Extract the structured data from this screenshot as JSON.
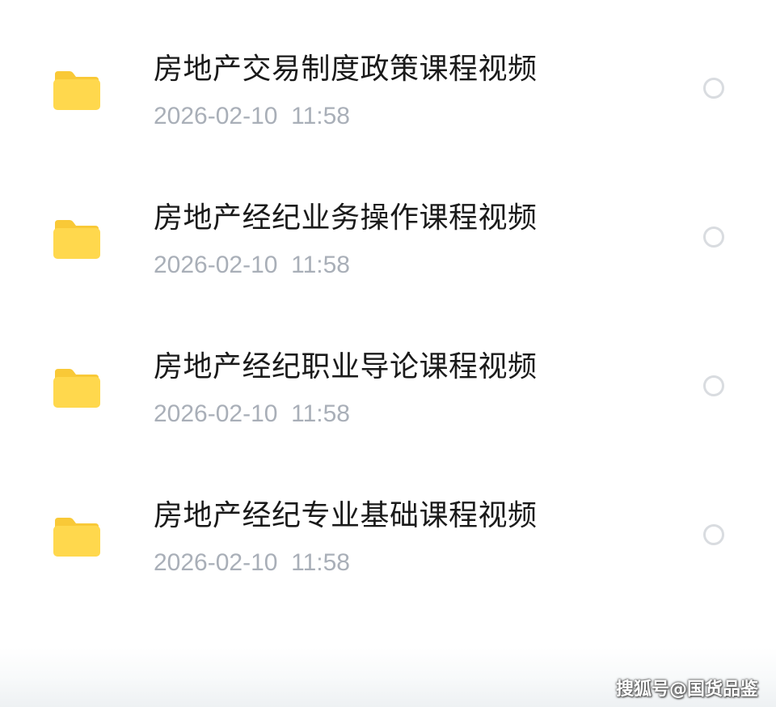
{
  "files": [
    {
      "name": "房地产交易制度政策课程视频",
      "date": "2026-02-10  11:58",
      "icon": "folder-icon"
    },
    {
      "name": "房地产经纪业务操作课程视频",
      "date": "2026-02-10  11:58",
      "icon": "folder-icon"
    },
    {
      "name": "房地产经纪职业导论课程视频",
      "date": "2026-02-10  11:58",
      "icon": "folder-icon"
    },
    {
      "name": "房地产经纪专业基础课程视频",
      "date": "2026-02-10  11:58",
      "icon": "folder-icon"
    }
  ],
  "watermark": "搜狐号@国货品鉴",
  "colors": {
    "folder": "#FFD84D",
    "folder_tab": "#F9C937",
    "title_text": "#1a1a1a",
    "date_text": "#a9afb8",
    "radio_border": "#d9dce0"
  }
}
